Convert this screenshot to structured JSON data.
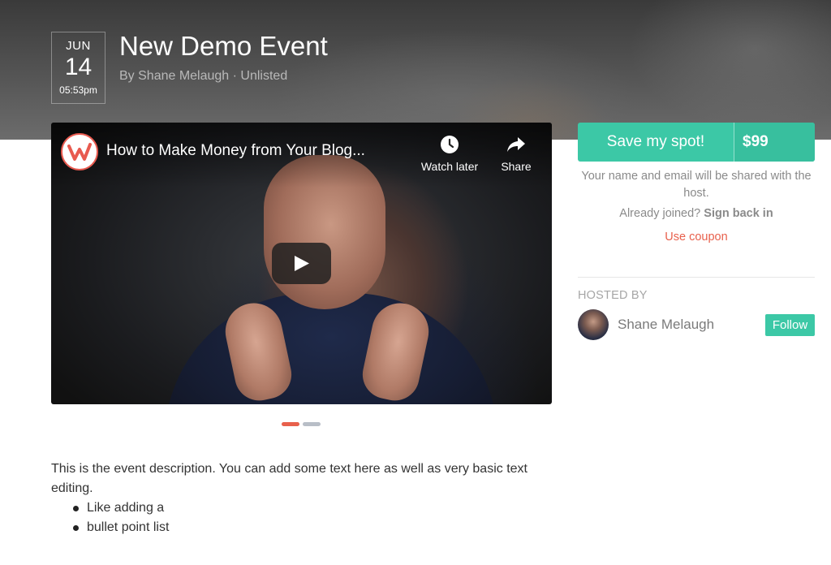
{
  "event": {
    "month": "JUN",
    "day": "14",
    "time": "05:53pm",
    "title": "New Demo Event",
    "meta": "By Shane Melaugh · Unlisted"
  },
  "video": {
    "title": "How to Make Money from Your Blog...",
    "watch_later_label": "Watch later",
    "share_label": "Share",
    "slides_total": 2,
    "slide_active": 1
  },
  "description": {
    "text": "This is the event description. You can add some text here as well as very basic text editing.",
    "bullets": [
      "Like adding a",
      "bullet point list"
    ]
  },
  "registration": {
    "button_label": "Save my spot!",
    "price": "$99",
    "share_note": "Your name and email will be shared with the host.",
    "already_joined": "Already joined?",
    "sign_back_in": "Sign back in",
    "coupon_link": "Use coupon"
  },
  "host": {
    "section_label": "HOSTED BY",
    "name": "Shane Melaugh",
    "follow_label": "Follow"
  },
  "colors": {
    "accent": "#3cc8a6",
    "coupon": "#e8604c"
  }
}
